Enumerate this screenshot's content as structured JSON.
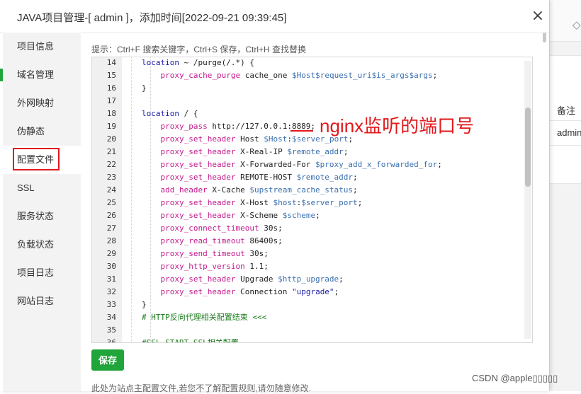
{
  "dialog": {
    "title": "JAVA项目管理-[ admin ]，添加时间[2022-09-21 09:39:45]",
    "close_icon": "×"
  },
  "sidebar": {
    "items": [
      {
        "label": "项目信息"
      },
      {
        "label": "域名管理"
      },
      {
        "label": "外网映射"
      },
      {
        "label": "伪静态"
      },
      {
        "label": "配置文件",
        "active": true
      },
      {
        "label": "SSL"
      },
      {
        "label": "服务状态"
      },
      {
        "label": "负载状态"
      },
      {
        "label": "项目日志"
      },
      {
        "label": "网站日志"
      }
    ]
  },
  "editor": {
    "tip": "提示：Ctrl+F 搜索关键字，Ctrl+S 保存，Ctrl+H 查找替换",
    "lines": [
      {
        "n": "14",
        "text": "location ~ /purge(/.*) {"
      },
      {
        "n": "15",
        "text": "    proxy_cache_purge cache_one $Host$request_uri$is_args$args;"
      },
      {
        "n": "16",
        "text": "}"
      },
      {
        "n": "17",
        "text": ""
      },
      {
        "n": "18",
        "text": "location / {"
      },
      {
        "n": "19",
        "text": "    proxy_pass http://127.0.0.1:8889;"
      },
      {
        "n": "20",
        "text": "    proxy_set_header Host $Host:$server_port;"
      },
      {
        "n": "21",
        "text": "    proxy_set_header X-Real-IP $remote_addr;"
      },
      {
        "n": "22",
        "text": "    proxy_set_header X-Forwarded-For $proxy_add_x_forwarded_for;"
      },
      {
        "n": "23",
        "text": "    proxy_set_header REMOTE-HOST $remote_addr;"
      },
      {
        "n": "24",
        "text": "    add_header X-Cache $upstream_cache_status;"
      },
      {
        "n": "25",
        "text": "    proxy_set_header X-Host $host:$server_port;"
      },
      {
        "n": "26",
        "text": "    proxy_set_header X-Scheme $scheme;"
      },
      {
        "n": "27",
        "text": "    proxy_connect_timeout 30s;"
      },
      {
        "n": "28",
        "text": "    proxy_read_timeout 86400s;"
      },
      {
        "n": "29",
        "text": "    proxy_send_timeout 30s;"
      },
      {
        "n": "30",
        "text": "    proxy_http_version 1.1;"
      },
      {
        "n": "31",
        "text": "    proxy_set_header Upgrade $http_upgrade;"
      },
      {
        "n": "32",
        "text": "    proxy_set_header Connection \"upgrade\";"
      },
      {
        "n": "33",
        "text": "}"
      },
      {
        "n": "34",
        "text": "# HTTP反向代理相关配置结束 <<<"
      },
      {
        "n": "35",
        "text": ""
      },
      {
        "n": "36",
        "text": "#SSL-START SSL相关配置"
      }
    ],
    "annotation": "nginx监听的端口号"
  },
  "actions": {
    "save_label": "保存"
  },
  "footer": {
    "note": "此处为站点主配置文件,若您不了解配置规则,请勿随意修改.",
    "watermark": "CSDN @apple▯▯▯▯▯"
  },
  "background": {
    "column_header": "备注",
    "cell": "admin",
    "diamond_icon": "◇"
  },
  "colors": {
    "accent_green": "#20a53a",
    "annotation_red": "#e2181c"
  }
}
